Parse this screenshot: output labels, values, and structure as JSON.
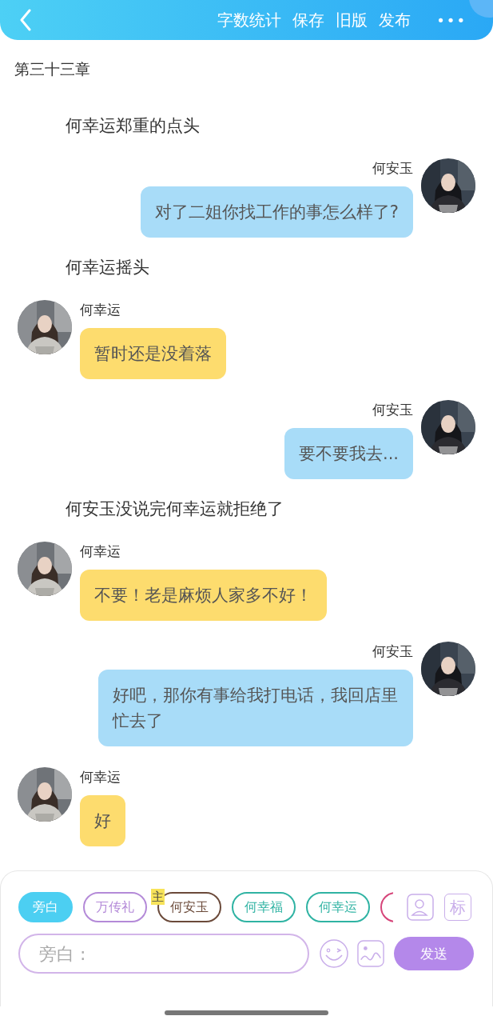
{
  "toolbar": {
    "actions": [
      "字数统计",
      "保存",
      "旧版",
      "发布"
    ],
    "more": "•••"
  },
  "chapter_title": "第三十三章",
  "messages": [
    {
      "kind": "narration",
      "text": "何幸运郑重的点头"
    },
    {
      "kind": "right",
      "speaker": "何安玉",
      "text": "对了二姐你找工作的事怎么样了?"
    },
    {
      "kind": "narration",
      "text": "何幸运摇头"
    },
    {
      "kind": "left",
      "speaker": "何幸运",
      "text": "暂时还是没着落"
    },
    {
      "kind": "right",
      "speaker": "何安玉",
      "text": "要不要我去..."
    },
    {
      "kind": "narration",
      "text": "何安玉没说完何幸运就拒绝了"
    },
    {
      "kind": "left",
      "speaker": "何幸运",
      "text": "不要！老是麻烦人家多不好！"
    },
    {
      "kind": "right",
      "speaker": "何安玉",
      "text": "好吧，那你有事给我打电话，我回店里忙去了"
    },
    {
      "kind": "left",
      "speaker": "何幸运",
      "text": "好"
    }
  ],
  "characters": [
    {
      "label": "旁白",
      "color": "#4ccff2",
      "selected": true
    },
    {
      "label": "万传礼",
      "color": "#b48ad8",
      "selected": false
    },
    {
      "label": "何安玉",
      "color": "#6b4a3a",
      "selected": false,
      "badge": "主"
    },
    {
      "label": "何幸福",
      "color": "#2fb3a3",
      "selected": false
    },
    {
      "label": "何幸运",
      "color": "#2fb3a3",
      "selected": false
    },
    {
      "color": "#d6457a",
      "selected": false
    }
  ],
  "role_tag": "标",
  "input": {
    "placeholder": "旁白 :"
  },
  "send_button": "发送"
}
